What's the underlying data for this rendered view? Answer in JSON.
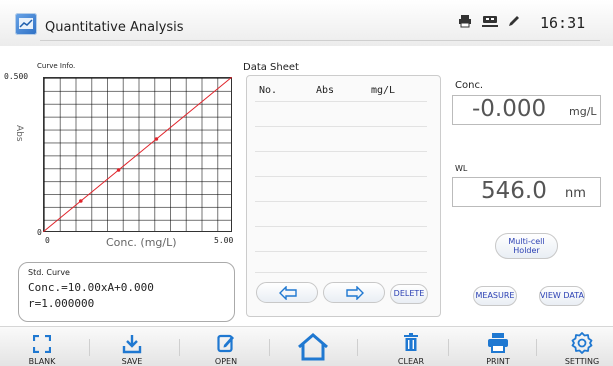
{
  "header": {
    "title": "Quantitative Analysis",
    "clock": "16:31",
    "icons": [
      "printer-icon",
      "usb-icon",
      "pen-icon"
    ]
  },
  "curve_panel": {
    "label": "Curve Info.",
    "y_label": "Abs",
    "x_label": "Conc. (mg/L)",
    "y_max_tick": "0.500",
    "y_min_tick": "0",
    "x_min_tick": "0",
    "x_max_tick": "5.00"
  },
  "chart_data": {
    "type": "line",
    "x": [
      0,
      1,
      2,
      3,
      4,
      5
    ],
    "y": [
      0,
      0.1,
      0.2,
      0.3,
      0.4,
      0.5
    ],
    "markers_at_x": [
      1,
      2,
      3
    ],
    "xlabel": "Conc. (mg/L)",
    "ylabel": "Abs",
    "xlim": [
      0,
      5
    ],
    "ylim": [
      0,
      0.5
    ],
    "grid": true,
    "line_color": "#e0242b"
  },
  "std_curve": {
    "title": "Std. Curve",
    "equation": "Conc.=10.00xA+0.000",
    "r_value": "r=1.000000"
  },
  "data_sheet": {
    "title": "Data Sheet",
    "columns": [
      "No.",
      "Abs",
      "mg/L"
    ],
    "rows": [],
    "delete_label": "DELETE",
    "prev_icon": "arrow-left-icon",
    "next_icon": "arrow-right-icon"
  },
  "readouts": {
    "conc_label": "Conc.",
    "conc_value": "-0.000",
    "conc_unit": "mg/L",
    "wl_label": "WL",
    "wl_value": "546.0",
    "wl_unit": "nm"
  },
  "buttons": {
    "multicell_line1": "Multi-cell",
    "multicell_line2": "Holder",
    "measure": "MEASURE",
    "view_data": "VIEW DATA"
  },
  "toolbar": {
    "blank": "BLANK",
    "save": "SAVE",
    "open": "OPEN",
    "clear": "CLEAR",
    "print": "PRINT",
    "setting": "SETTING"
  },
  "colors": {
    "accent_blue": "#1f78d1",
    "button_text": "#2a3fb3",
    "curve_red": "#e0242b"
  }
}
